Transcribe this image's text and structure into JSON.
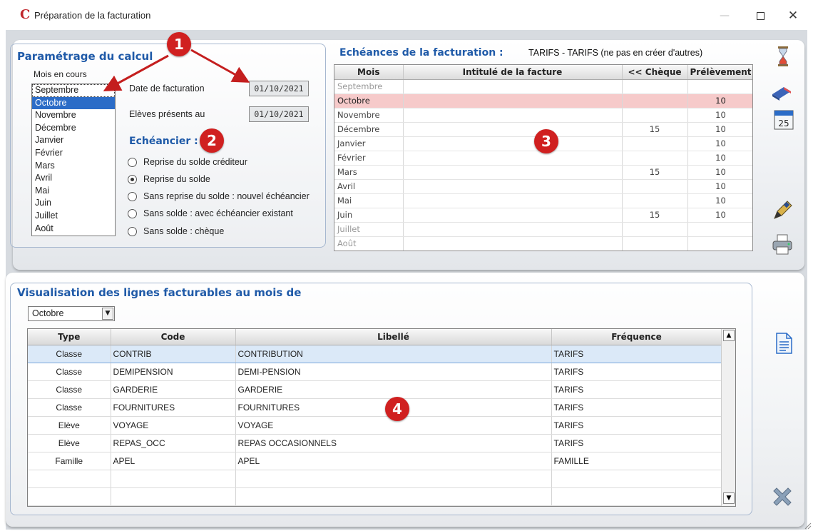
{
  "window": {
    "title": "Préparation de la facturation",
    "app_icon": "app-logo-c",
    "minimize_glyph": "—",
    "close_glyph": "✕"
  },
  "calc": {
    "title": "Paramétrage du calcul",
    "months_label": "Mois en cours",
    "months": [
      "Septembre",
      "Octobre",
      "Novembre",
      "Décembre",
      "Janvier",
      "Février",
      "Mars",
      "Avril",
      "Mai",
      "Juin",
      "Juillet",
      "Août"
    ],
    "selected_month": "Octobre",
    "date_facturation_label": "Date de facturation",
    "date_facturation": "01/10/2021",
    "eleves_label": "Elèves présents au",
    "eleves_date": "01/10/2021",
    "echeancier_title": "Echéancier :",
    "options": [
      {
        "label": "Reprise du solde créditeur",
        "checked": false
      },
      {
        "label": "Reprise du solde",
        "checked": true
      },
      {
        "label": "Sans reprise du solde : nouvel échéancier",
        "checked": false
      },
      {
        "label": "Sans solde : avec échéancier existant",
        "checked": false
      },
      {
        "label": "Sans solde : chèque",
        "checked": false
      }
    ]
  },
  "echeances": {
    "title": "Echéances de la facturation :",
    "subtitle": "TARIFS - TARIFS (ne pas en créer d'autres)",
    "columns": [
      "Mois",
      "Intitulé de la facture",
      "<< Chèque",
      "Prélèvement"
    ],
    "rows": [
      {
        "mois": "Septembre",
        "intitule": "",
        "cheque": "",
        "prelevement": ""
      },
      {
        "mois": "Octobre",
        "intitule": "",
        "cheque": "",
        "prelevement": "10"
      },
      {
        "mois": "Novembre",
        "intitule": "",
        "cheque": "",
        "prelevement": "10"
      },
      {
        "mois": "Décembre",
        "intitule": "",
        "cheque": "15",
        "prelevement": "10"
      },
      {
        "mois": "Janvier",
        "intitule": "",
        "cheque": "",
        "prelevement": "10"
      },
      {
        "mois": "Février",
        "intitule": "",
        "cheque": "",
        "prelevement": "10"
      },
      {
        "mois": "Mars",
        "intitule": "",
        "cheque": "15",
        "prelevement": "10"
      },
      {
        "mois": "Avril",
        "intitule": "",
        "cheque": "",
        "prelevement": "10"
      },
      {
        "mois": "Mai",
        "intitule": "",
        "cheque": "",
        "prelevement": "10"
      },
      {
        "mois": "Juin",
        "intitule": "",
        "cheque": "15",
        "prelevement": "10"
      },
      {
        "mois": "Juillet",
        "intitule": "",
        "cheque": "",
        "prelevement": ""
      },
      {
        "mois": "Août",
        "intitule": "",
        "cheque": "",
        "prelevement": ""
      }
    ],
    "highlight_color": "#f6caca"
  },
  "visualisation": {
    "title": "Visualisation des lignes facturables au mois de",
    "month_value": "Octobre",
    "columns": [
      "Type",
      "Code",
      "Libellé",
      "Fréquence"
    ],
    "rows": [
      {
        "type": "Classe",
        "code": "CONTRIB",
        "libelle": "CONTRIBUTION",
        "frequence": "TARIFS"
      },
      {
        "type": "Classe",
        "code": "DEMIPENSION",
        "libelle": "DEMI-PENSION",
        "frequence": "TARIFS"
      },
      {
        "type": "Classe",
        "code": "GARDERIE",
        "libelle": "GARDERIE",
        "frequence": "TARIFS"
      },
      {
        "type": "Classe",
        "code": "FOURNITURES",
        "libelle": "FOURNITURES",
        "frequence": "TARIFS"
      },
      {
        "type": "Elève",
        "code": "VOYAGE",
        "libelle": "VOYAGE",
        "frequence": "TARIFS"
      },
      {
        "type": "Elève",
        "code": "REPAS_OCC",
        "libelle": "REPAS OCCASIONNELS",
        "frequence": "TARIFS"
      },
      {
        "type": "Famille",
        "code": "APEL",
        "libelle": "APEL",
        "frequence": "FAMILLE"
      }
    ]
  },
  "markers": [
    "1",
    "2",
    "3",
    "4"
  ],
  "colors": {
    "accent": "#1f5aa8",
    "marker": "#d02020",
    "selection": "#2b6cc7",
    "arrow": "#c41e1e"
  },
  "side_icons": [
    "hourglass-icon",
    "eraser-icon",
    "calendar-icon",
    "pen-icon",
    "printer-icon",
    "document-icon",
    "close-x-icon"
  ],
  "calendar_icon_text": "25"
}
